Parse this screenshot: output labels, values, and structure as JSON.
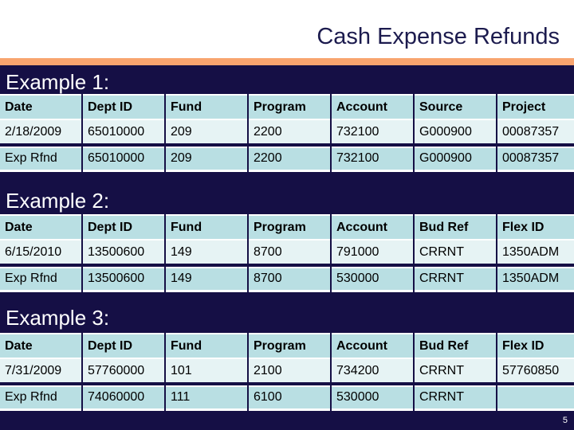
{
  "slide": {
    "title": "Cash Expense Refunds",
    "page_number": "5",
    "colors": {
      "navy": "#150f45",
      "orange": "#f8a46e",
      "header_cell": "#b9dfe3",
      "light_cell": "#e6f3f4",
      "title_text": "#1c1b4e"
    }
  },
  "examples": [
    {
      "label": "Example 1:",
      "headers": [
        "Date",
        "Dept ID",
        "Fund",
        "Program",
        "Account",
        "Source",
        "Project"
      ],
      "rows": [
        [
          "2/18/2009",
          "65010000",
          "209",
          "2200",
          "732100",
          "G000900",
          "00087357"
        ],
        [
          "Exp Rfnd",
          "65010000",
          "209",
          "2200",
          "732100",
          "G000900",
          "00087357"
        ]
      ]
    },
    {
      "label": "Example 2:",
      "headers": [
        "Date",
        "Dept ID",
        "Fund",
        "Program",
        "Account",
        "Bud Ref",
        "Flex ID"
      ],
      "rows": [
        [
          "6/15/2010",
          "13500600",
          "149",
          "8700",
          "791000",
          "CRRNT",
          "1350ADM"
        ],
        [
          "Exp Rfnd",
          "13500600",
          "149",
          "8700",
          "530000",
          "CRRNT",
          "1350ADM"
        ]
      ]
    },
    {
      "label": "Example 3:",
      "headers": [
        "Date",
        "Dept ID",
        "Fund",
        "Program",
        "Account",
        "Bud Ref",
        "Flex ID"
      ],
      "rows": [
        [
          "7/31/2009",
          "57760000",
          "101",
          "2100",
          "734200",
          "CRRNT",
          "57760850"
        ],
        [
          "Exp Rfnd",
          "74060000",
          "111",
          "6100",
          "530000",
          "CRRNT",
          ""
        ]
      ]
    }
  ]
}
